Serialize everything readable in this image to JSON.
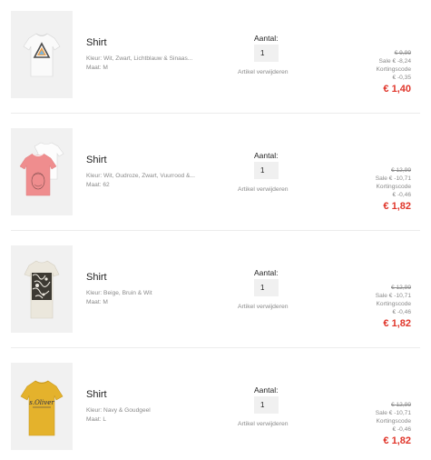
{
  "items": [
    {
      "name": "Shirt",
      "color_line": "Kleur: Wit, Zwart, Lichtblauw & Sinaas...",
      "size_line": "Maat: M",
      "quantity_label": "Aantal:",
      "quantity_value": "1",
      "remove_label": "Artikel verwijderen",
      "original_price": "€ 9,99",
      "sale_line": "Sale € -8,24",
      "discount_code_label": "Kortingscode",
      "discount_code_value": "€ -0,35",
      "final_price": "€ 1,40"
    },
    {
      "name": "Shirt",
      "color_line": "Kleur: Wit, Oudroze, Zwart, Vuurrood &...",
      "size_line": "Maat: 62",
      "quantity_label": "Aantal:",
      "quantity_value": "1",
      "remove_label": "Artikel verwijderen",
      "original_price": "€ 12,99",
      "sale_line": "Sale € -10,71",
      "discount_code_label": "Kortingscode",
      "discount_code_value": "€ -0,46",
      "final_price": "€ 1,82"
    },
    {
      "name": "Shirt",
      "color_line": "Kleur: Beige, Bruin & Wit",
      "size_line": "Maat: M",
      "quantity_label": "Aantal:",
      "quantity_value": "1",
      "remove_label": "Artikel verwijderen",
      "original_price": "€ 12,99",
      "sale_line": "Sale € -10,71",
      "discount_code_label": "Kortingscode",
      "discount_code_value": "€ -0,46",
      "final_price": "€ 1,82"
    },
    {
      "name": "Shirt",
      "color_line": "Kleur: Navy & Goudgeel",
      "size_line": "Maat: L",
      "quantity_label": "Aantal:",
      "quantity_value": "1",
      "remove_label": "Artikel verwijderen",
      "original_price": "€ 12,99",
      "sale_line": "Sale € -10,71",
      "discount_code_label": "Kortingscode",
      "discount_code_value": "€ -0,46",
      "final_price": "€ 1,82"
    }
  ],
  "product_images": [
    "white-tshirt-triangle-print",
    "pink-and-white-baby-tshirts",
    "beige-tshirt-floral-print",
    "yellow-tshirt-logo-print"
  ],
  "image_lettering": [
    "s.Oliver"
  ],
  "colors": {
    "final_price": "#e0362b",
    "muted_text": "#8a8a8a",
    "quantity_box_bg": "#f0f0f0",
    "thumbnail_bg": "#f1f1f1"
  }
}
